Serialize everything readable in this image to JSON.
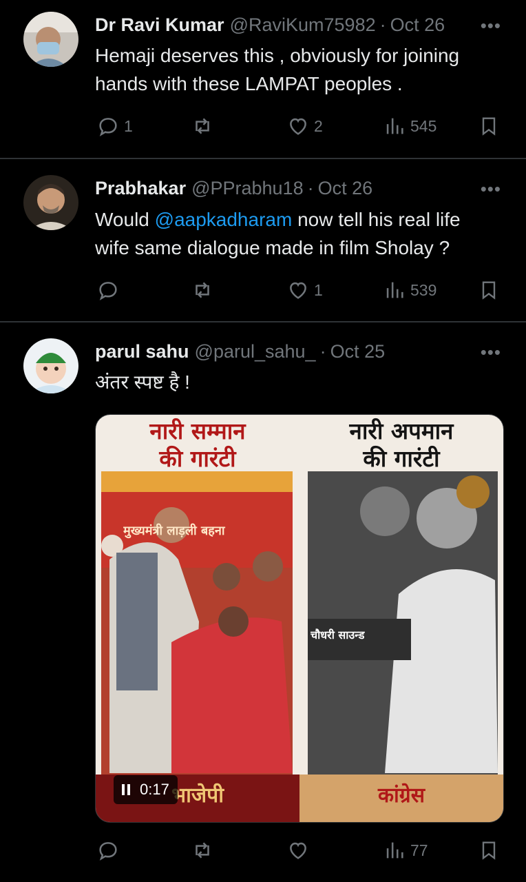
{
  "tweets": [
    {
      "name": "Dr Ravi Kumar",
      "handle": "@RaviKum75982",
      "date": "Oct 26",
      "text": "Hemaji deserves this , obviously for joining hands with these LAMPAT peoples .",
      "replies": "1",
      "retweets": "",
      "likes": "2",
      "views": "545"
    },
    {
      "name": "Prabhakar",
      "handle": "@PPrabhu18",
      "date": "Oct 26",
      "text_before": "Would ",
      "mention": "@aapkadharam",
      "text_after": " now tell his real life wife same dialogue made in film Sholay ?",
      "replies": "",
      "retweets": "",
      "likes": "1",
      "views": "539"
    },
    {
      "name": "parul sahu",
      "handle": "@parul_sahu_",
      "date": "Oct 25",
      "text": "अंतर स्पष्ट है !",
      "replies": "",
      "retweets": "",
      "likes": "",
      "views": "77",
      "media": {
        "left_title_1": "नारी सम्मान",
        "left_title_2": "की गारंटी",
        "right_title_1": "नारी अपमान",
        "right_title_2": "की गारंटी",
        "left_banner": "मुख्यमंत्री लाड़ली बहना",
        "right_sign": "चौधरी साउन्ड",
        "left_caption": "भाजेपी",
        "right_caption": "कांग्रेस",
        "video_time": "0:17"
      }
    }
  ],
  "more_label": "•••"
}
